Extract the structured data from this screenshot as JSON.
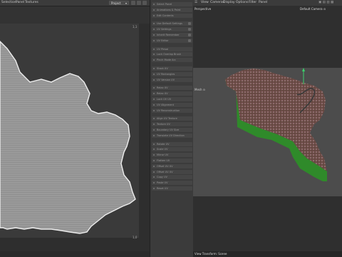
{
  "left_menu": {
    "items": [
      "Selection",
      "Panel",
      "Textures"
    ]
  },
  "project_select": {
    "value": "Project"
  },
  "uv_corner_labels": {
    "top_right": "1,1",
    "bottom_right": "1,0"
  },
  "side_panel": {
    "groups": [
      [
        "Select Panel",
        "Animations & Paint",
        "Edit Contents"
      ],
      [
        "Use Default Settings",
        "UV Settings",
        "Inherit Remember",
        "UV Editor"
      ],
      [
        "UV Pinsoi",
        "Lock Overlap Brush",
        "Pinch Mode Arc"
      ],
      [
        "Stack UV",
        "UV Rectangles",
        "UV Version UV"
      ],
      [
        "Relax UV",
        "Relax UV",
        "Lock UV UV",
        "UV Alignment",
        "UV Reconstruction"
      ],
      [
        "Align UV Texture",
        "Texture UV",
        "Boundary UV Size",
        "Translate UV Direction"
      ],
      [
        "Rotate UV",
        "Scale UV",
        "Mirror UV",
        "Flatten UV",
        "Offset UV UV",
        "Offset UV UV",
        "Copy UV",
        "Paste UV",
        "Reset UV"
      ]
    ]
  },
  "right_menu": {
    "items": [
      "View",
      "Cameras",
      "Display",
      "Options",
      "Filter",
      "Panel"
    ]
  },
  "viewport": {
    "perspective_label": "Perspective",
    "camera_label": "Default Camera ⊙",
    "side_label": "Mesh ⊙"
  },
  "status_bar": {
    "text": "View Transform: Scene"
  },
  "colors": {
    "uv_fill": "#9a9a9a",
    "green": "#2f8a2a",
    "terrain": "#6e4a48",
    "axis_green": "#3bd16b"
  }
}
